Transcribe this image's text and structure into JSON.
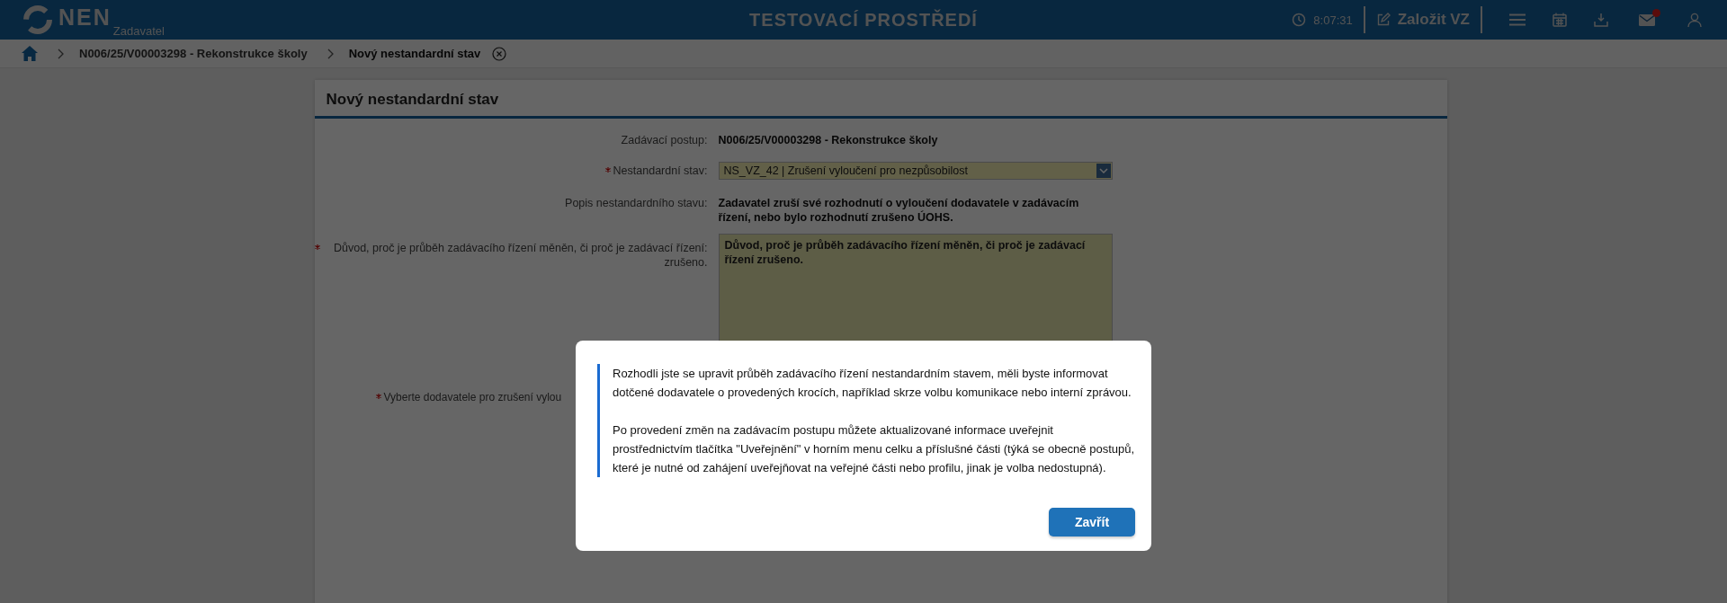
{
  "header": {
    "logo": "NEN",
    "logo_sub": "Zadavatel",
    "title": "TESTOVACÍ PROSTŘEDÍ",
    "time": "8:07:31",
    "create_button": "Založit VZ",
    "mail_unread": true
  },
  "breadcrumb": [
    {
      "kind": "home"
    },
    {
      "kind": "link",
      "label": "N006/25/V00003298 - Rekonstrukce školy"
    },
    {
      "kind": "current",
      "label": "Nový nestandardní stav"
    }
  ],
  "form": {
    "title": "Nový nestandardní stav",
    "rows": [
      {
        "kind": "text",
        "label": "Zadávací postup:",
        "required": false,
        "value": "N006/25/V00003298 - Rekonstrukce školy"
      },
      {
        "kind": "select",
        "label": "Nestandardní stav:",
        "required": true,
        "value": "NS_VZ_42 | Zrušení vyloučení pro nezpůsobilost"
      },
      {
        "kind": "text",
        "label": "Popis nestandardního stavu:",
        "required": false,
        "value": "Zadavatel zruší své rozhodnutí o vyloučení dodavatele v zadávacím řízení, nebo  bylo rozhodnutí  zrušeno ÚOHS."
      },
      {
        "kind": "textarea",
        "label": "Důvod, proč je průběh zadávacího řízení měněn, či proč je zadávací řízení: zrušeno.",
        "required": true,
        "value": "Důvod, proč je průběh zadávacího řízení měněn, či proč je zadávací řízení zrušeno."
      },
      {
        "kind": "covered",
        "label": "Vyberte dodavatele pro zrušení vylou",
        "required": true
      }
    ]
  },
  "dialog": {
    "paragraphs": [
      "Rozhodli jste se upravit průběh zadávacího řízení nestandardním stavem, měli byste informovat dotčené dodavatele o provedených krocích, například skrze volbu komunikace nebo interní zprávou.",
      "Po provedení změn na zadávacím postupu můžete aktualizované informace uveřejnit prostřednictvím tlačítka \"Uveřejnění\" v horním menu celku a příslušné části (týká se obecně postupů, které je nutné od zahájení uveřejňovat na veřejné části nebo profilu, jinak je volba nedostupná)."
    ],
    "button": "Zavřít"
  }
}
